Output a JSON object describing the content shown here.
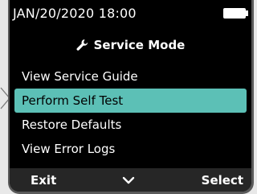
{
  "status_bar": {
    "datetime": "JAN/20/2020 18:00",
    "battery_icon": "battery-icon"
  },
  "header": {
    "icon": "wrench-icon",
    "title": "Service Mode"
  },
  "menu": {
    "items": [
      {
        "label": "View Service Guide",
        "selected": false
      },
      {
        "label": "Perform Self Test",
        "selected": true
      },
      {
        "label": "Restore Defaults",
        "selected": false
      },
      {
        "label": "View Error Logs",
        "selected": false
      }
    ]
  },
  "softkeys": {
    "left_label": "Exit",
    "center_icon": "chevron-down-icon",
    "right_label": "Select"
  },
  "colors": {
    "screen_bg": "#000000",
    "highlight": "#5cc0b6",
    "softkey_bar": "#262626",
    "bezel": "#5a5a5a"
  }
}
